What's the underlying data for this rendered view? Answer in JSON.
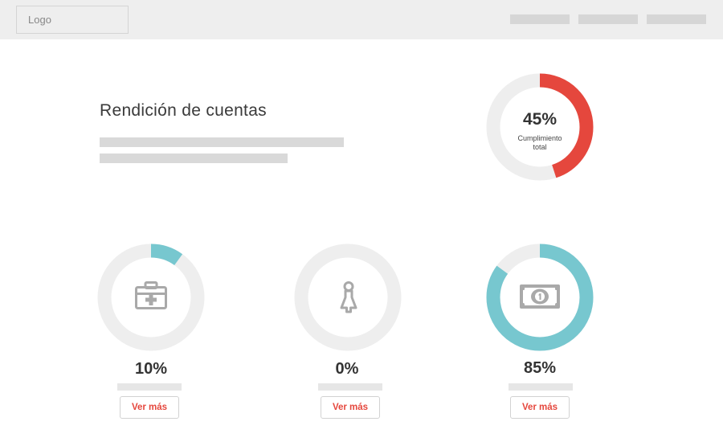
{
  "header": {
    "logo": "Logo",
    "nav": [
      "",
      "",
      ""
    ]
  },
  "hero": {
    "title": "Rendición de cuentas",
    "summary": {
      "value": "45%",
      "fraction": 0.45,
      "caption_line1": "Cumplimiento",
      "caption_line2": "total",
      "color": "#e5473d",
      "track_color": "#eeeeee"
    }
  },
  "stats": [
    {
      "icon": "first-aid-kit-icon",
      "value": "10%",
      "fraction": 0.1,
      "color": "#77c7cf",
      "button": "Ver más"
    },
    {
      "icon": "person-icon",
      "value": "0%",
      "fraction": 0.0,
      "color": "#77c7cf",
      "button": "Ver más"
    },
    {
      "icon": "banknote-icon",
      "value": "85%",
      "fraction": 0.85,
      "color": "#77c7cf",
      "button": "Ver más"
    }
  ],
  "colors": {
    "track": "#eeeeee",
    "accent_red": "#e5473d",
    "accent_teal": "#77c7cf",
    "icon_gray": "#a9a9a9"
  }
}
